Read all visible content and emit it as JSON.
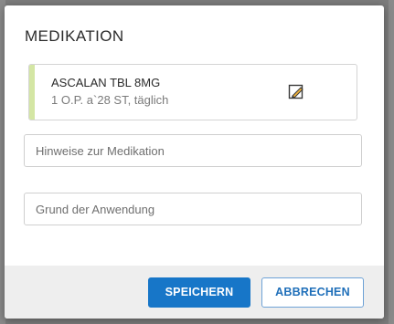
{
  "dialog": {
    "title": "MEDIKATION",
    "medication": {
      "name": "ASCALAN TBL 8MG",
      "dosage": "1 O.P. a`28 ST, täglich",
      "accent_color": "#d4e6a4",
      "edit_icon": "edit-pencil-icon"
    },
    "fields": {
      "hint_placeholder": "Hinweise zur Medikation",
      "hint_value": "",
      "reason_placeholder": "Grund der Anwendung",
      "reason_value": ""
    },
    "buttons": {
      "save_label": "SPEICHERN",
      "cancel_label": "ABBRECHEN"
    },
    "colors": {
      "primary": "#1776c8",
      "footer_bg": "#eeeeee"
    }
  }
}
